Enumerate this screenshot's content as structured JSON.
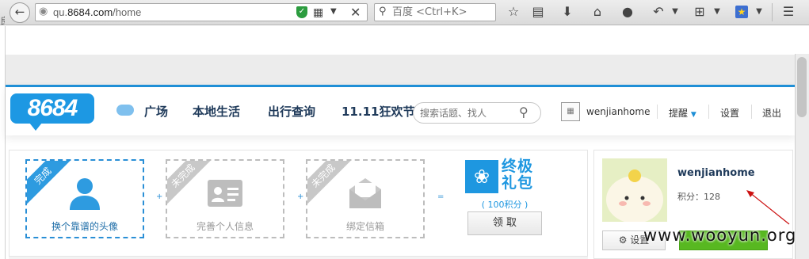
{
  "browser": {
    "url_prefix": "qu.",
    "url_domain": "8684.com",
    "url_path": "/home",
    "search_placeholder": "百度 <Ctrl+K>",
    "side_fragment": "良"
  },
  "site": {
    "logo": "8684",
    "nav": [
      "广场",
      "本地生活",
      "出行查询",
      "11.11狂欢节"
    ],
    "search_placeholder": "搜索话题、找人",
    "username": "wenjianhome",
    "links": {
      "remind": "提醒",
      "settings": "设置",
      "logout": "退出"
    }
  },
  "tasks": [
    {
      "ribbon": "完成",
      "label": "换个靠谱的头像",
      "done": true,
      "icon": "user-icon"
    },
    {
      "ribbon": "未完成",
      "label": "完善个人信息",
      "done": false,
      "icon": "id-card-icon"
    },
    {
      "ribbon": "未完成",
      "label": "绑定信箱",
      "done": false,
      "icon": "envelope-icon"
    }
  ],
  "connectors": {
    "plus": "+",
    "equals": "="
  },
  "gift": {
    "title_line1": "终极",
    "title_line2": "礼包",
    "points": "( 100积分 )",
    "claim": "领 取"
  },
  "profile": {
    "name": "wenjianhome",
    "score": "积分：128",
    "settings": "设置",
    "green_button": ""
  },
  "watermark": "www.wooyun.org",
  "colors": {
    "accent": "#1f8fd6",
    "green": "#58b821",
    "arrow": "#cc1111"
  }
}
